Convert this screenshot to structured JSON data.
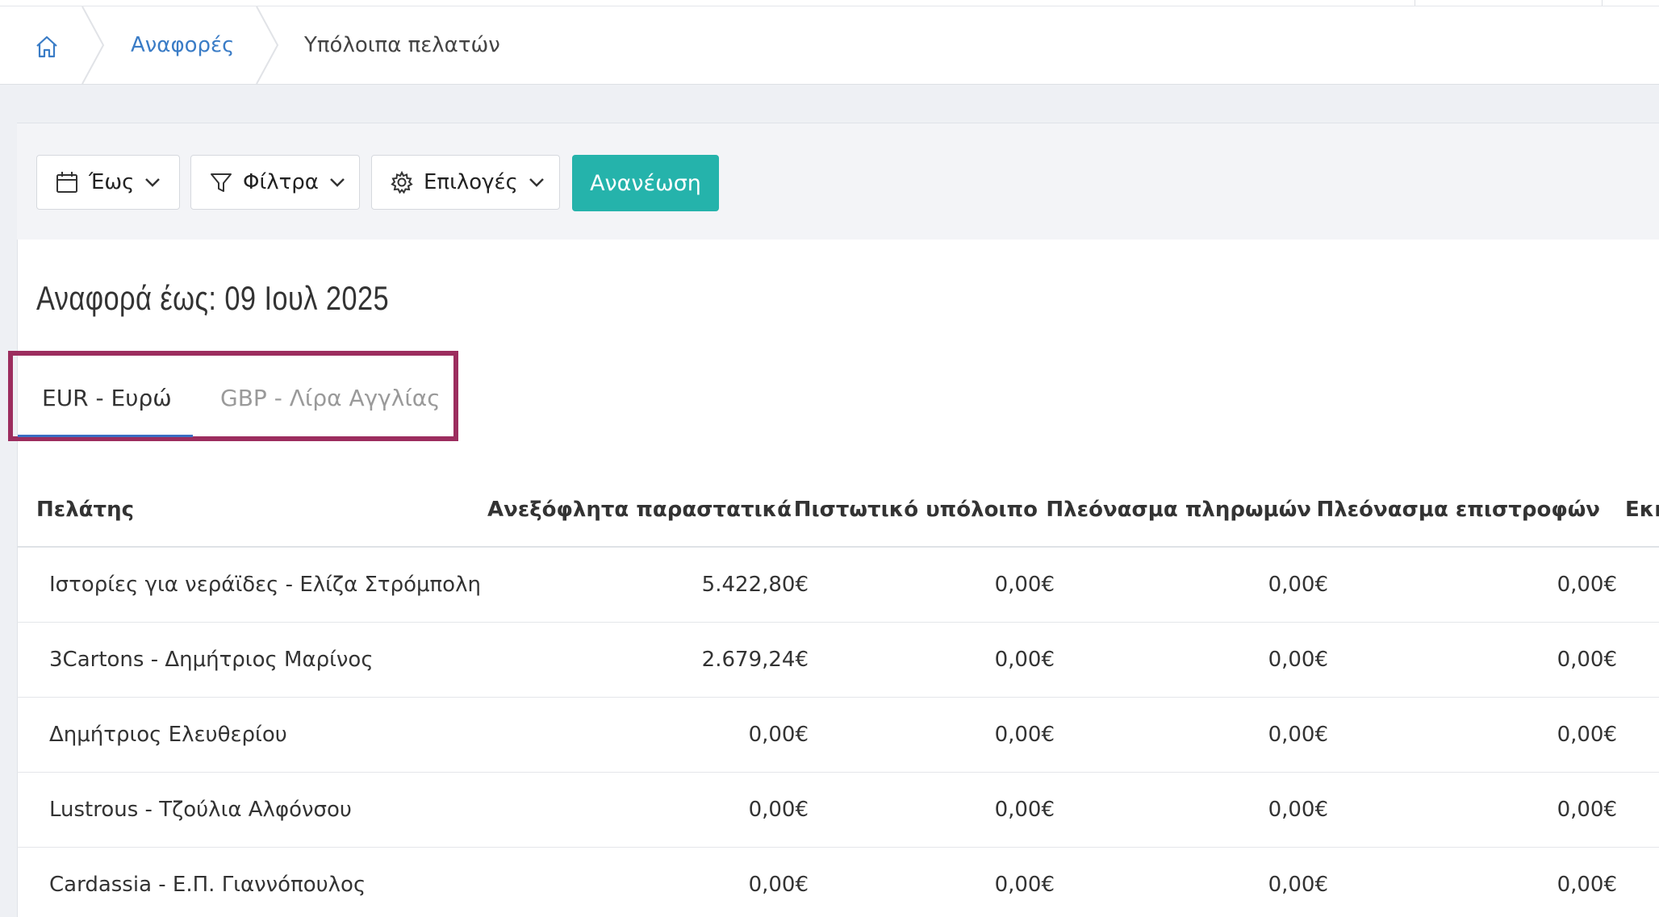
{
  "breadcrumb": {
    "home_icon": "home-icon",
    "reports_label": "Αναφορές",
    "current_label": "Υπόλοιπα πελατών"
  },
  "toolbar": {
    "date_label": "Έως",
    "filters_label": "Φίλτρα",
    "options_label": "Επιλογές",
    "refresh_label": "Ανανέωση",
    "refresh_color": "#25b3ab"
  },
  "report": {
    "title": "Αναφορά έως: 09 Ιουλ 2025"
  },
  "tabs": [
    {
      "label": "EUR - Ευρώ",
      "active": true
    },
    {
      "label": "GBP - Λίρα Αγγλίας",
      "active": false
    }
  ],
  "table": {
    "headers": [
      "Πελάτης",
      "Ανεξόφλητα παραστατικά",
      "Πιστωτικό υπόλοιπο",
      "Πλεόνασμα πληρωμών",
      "Πλεόνασμα επιστροφών",
      "Εκκ"
    ],
    "rows": [
      [
        "Ιστορίες για νεράϊδες - Ελίζα Στρόμπολη",
        "5.422,80€",
        "0,00€",
        "0,00€",
        "0,00€"
      ],
      [
        "3Cartons - Δημήτριος Μαρίνος",
        "2.679,24€",
        "0,00€",
        "0,00€",
        "0,00€"
      ],
      [
        "Δημήτριος Ελευθερίου",
        "0,00€",
        "0,00€",
        "0,00€",
        "0,00€"
      ],
      [
        "Lustrous - Τζούλια Αλφόνσου",
        "0,00€",
        "0,00€",
        "0,00€",
        "0,00€"
      ],
      [
        "Cardassia - Ε.Π. Γιαννόπουλος",
        "0,00€",
        "0,00€",
        "0,00€",
        "0,00€"
      ]
    ]
  }
}
